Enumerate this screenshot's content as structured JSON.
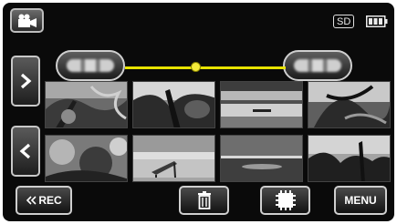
{
  "top_bar": {
    "mode_icon": "video-camera-icon",
    "media_badge": "SD",
    "battery_icon": "battery-icon"
  },
  "date_bar": {
    "prev_date_icon": "date-blurred-icon",
    "next_date_icon": "date-blurred-icon",
    "date_label": "",
    "slider_position_fraction": 0.44
  },
  "navigation": {
    "next_page_icon": "chevron-right-icon",
    "prev_page_icon": "chevron-left-icon"
  },
  "thumbnails": [
    {
      "scene": "palm-leaves"
    },
    {
      "scene": "tree-sky"
    },
    {
      "scene": "horizon-water"
    },
    {
      "scene": "palm-fronds"
    },
    {
      "scene": "foliage"
    },
    {
      "scene": "beach-chair"
    },
    {
      "scene": "sea-sunset"
    },
    {
      "scene": "tree-silhouette"
    }
  ],
  "bottom_bar": {
    "rec_label": "REC",
    "rec_prefix_icon": "double-chevron-left-icon",
    "delete_icon": "trash-icon",
    "stop_icon": "stop-icon",
    "menu_label": "MENU"
  },
  "colors": {
    "slider": "#e8e300",
    "button_border": "#cfcfcf",
    "background": "#0a0a0a"
  }
}
